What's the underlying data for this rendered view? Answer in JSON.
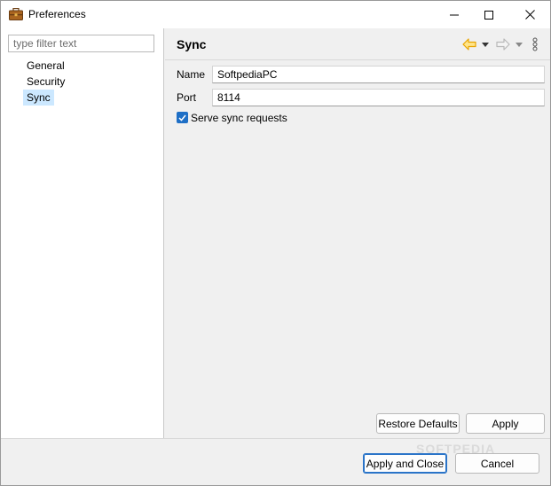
{
  "window": {
    "title": "Preferences",
    "controls": {
      "minimize": "minimize",
      "maximize": "maximize",
      "close": "close"
    }
  },
  "sidebar": {
    "filter_placeholder": "type filter text",
    "items": [
      {
        "label": "General",
        "selected": false
      },
      {
        "label": "Security",
        "selected": false
      },
      {
        "label": "Sync",
        "selected": true
      }
    ]
  },
  "page": {
    "title": "Sync",
    "fields": {
      "name_label": "Name",
      "name_value": "SoftpediaPC",
      "port_label": "Port",
      "port_value": "8114"
    },
    "serve_sync": {
      "label": "Serve sync requests",
      "checked": true
    },
    "buttons": {
      "restore_defaults": "Restore Defaults",
      "apply": "Apply"
    },
    "icons": [
      "back-arrow-icon",
      "chevron-down-icon",
      "forward-arrow-icon",
      "chevron-down-icon",
      "more-vertical-icon"
    ]
  },
  "footer": {
    "apply_and_close": "Apply and Close",
    "cancel": "Cancel"
  },
  "watermark": "SOFTPEDIA",
  "colors": {
    "accent": "#1e6fc6",
    "selection": "#cce8ff",
    "back_arrow": "#e8a400",
    "forward_arrow_disabled": "#b8b8b8"
  }
}
